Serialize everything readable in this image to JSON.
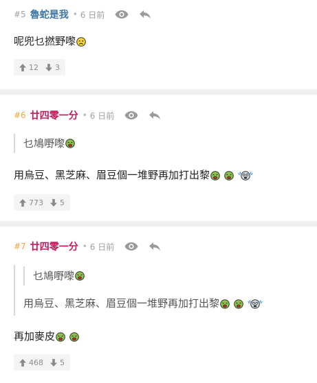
{
  "posts": [
    {
      "number": "#5",
      "username": "魯蛇是我",
      "time": "6 日前",
      "content": "呢兜乜撚野嚟",
      "upvotes": "12",
      "downvotes": "3"
    },
    {
      "number": "#6",
      "username": "廿四零一分",
      "time": "6 日前",
      "quote": "乜鳩嘢嚟",
      "content": "用烏豆、黑芝麻、眉豆個一堆野再加打出黎",
      "upvotes": "773",
      "downvotes": "5"
    },
    {
      "number": "#7",
      "username": "廿四零一分",
      "time": "6 日前",
      "quote_outer": "乜鳩嘢嚟",
      "quote_inner": "用烏豆、黑芝麻、眉豆個一堆野再加打出黎",
      "content": "再加麥皮",
      "upvotes": "468",
      "downvotes": "5"
    }
  ],
  "separator": "•",
  "colors": {
    "username_blue": "#3e76a6",
    "username_red": "#c2185b",
    "post_number_orange": "#f0a43a",
    "divider": "#efefef"
  },
  "icons": [
    "eye-icon",
    "reply-icon",
    "arrow-up-icon",
    "arrow-down-icon",
    "sad-emoji-icon",
    "sick-emoji-icon",
    "crying-emoji-icon"
  ]
}
